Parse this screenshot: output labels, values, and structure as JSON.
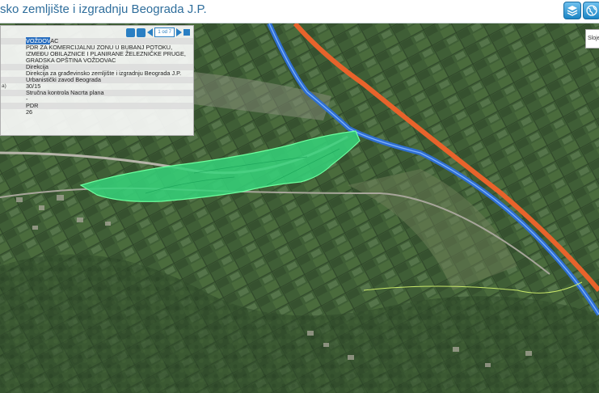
{
  "header": {
    "title": "sko zemljište i izgradnju Beograda J.P.",
    "buttons": [
      {
        "icon": "layers-icon"
      },
      {
        "icon": "globe-icon"
      }
    ]
  },
  "info_panel": {
    "toolbar": {
      "page_indicator": "1 od 7"
    },
    "rows": [
      {
        "label": "",
        "value": "VOŽDOVAC",
        "highlight_word": "VOŽDOV",
        "suffix": "AC"
      },
      {
        "label": "",
        "value": "PDR ZA KOMERCIJALNU ZONU U BUBANJ POTOKU, IZMEĐU OBILAZNICE I PLANIRANE ŽELEZNIČKE PRUGE, GRADSKA OPŠTINA VOŽDOVAC"
      },
      {
        "label": "",
        "value": "Direkcija"
      },
      {
        "label": "",
        "value": "Direkcija za građevinsko zemljište i izgradnju Beograda J.P."
      },
      {
        "label": "",
        "value": "Urbanistički zavod Beograda"
      },
      {
        "label": "a)",
        "value": "30/15"
      },
      {
        "label": "",
        "value": "Stručna kontrola Nacrta plana"
      },
      {
        "label": "",
        "value": "-"
      },
      {
        "label": "",
        "value": "PDR"
      },
      {
        "label": "",
        "value": "26"
      }
    ]
  },
  "side_button": {
    "label": "Slojev"
  },
  "map_colors": {
    "plan_area": "#35d47a",
    "road_orange": "#e8632b",
    "road_blue": "#2f6fd0",
    "terrain": "#3d5a34"
  }
}
